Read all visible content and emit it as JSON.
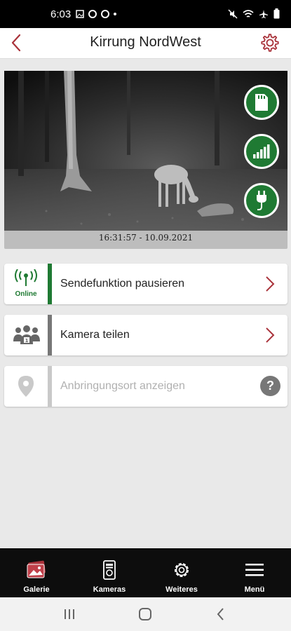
{
  "status_bar": {
    "time": "6:03"
  },
  "header": {
    "title": "Kirrung NordWest"
  },
  "preview": {
    "timestamp": "16:31:57 - 10.09.2021"
  },
  "rows": [
    {
      "label": "Sendefunktion pausieren",
      "status": "Online",
      "accent": "#1f7a33"
    },
    {
      "label": "Kamera teilen",
      "accent": "#777777"
    },
    {
      "label": "Anbringungsort anzeigen",
      "accent": "#c9c9c9",
      "help": "?"
    }
  ],
  "bottom_nav": [
    {
      "label": "Galerie",
      "icon": "gallery-icon"
    },
    {
      "label": "Kameras",
      "icon": "camera-device-icon"
    },
    {
      "label": "Weiteres",
      "icon": "gear-icon"
    },
    {
      "label": "Menü",
      "icon": "menu-icon"
    }
  ],
  "colors": {
    "brand_red": "#a9323a",
    "green": "#1f7a33"
  }
}
